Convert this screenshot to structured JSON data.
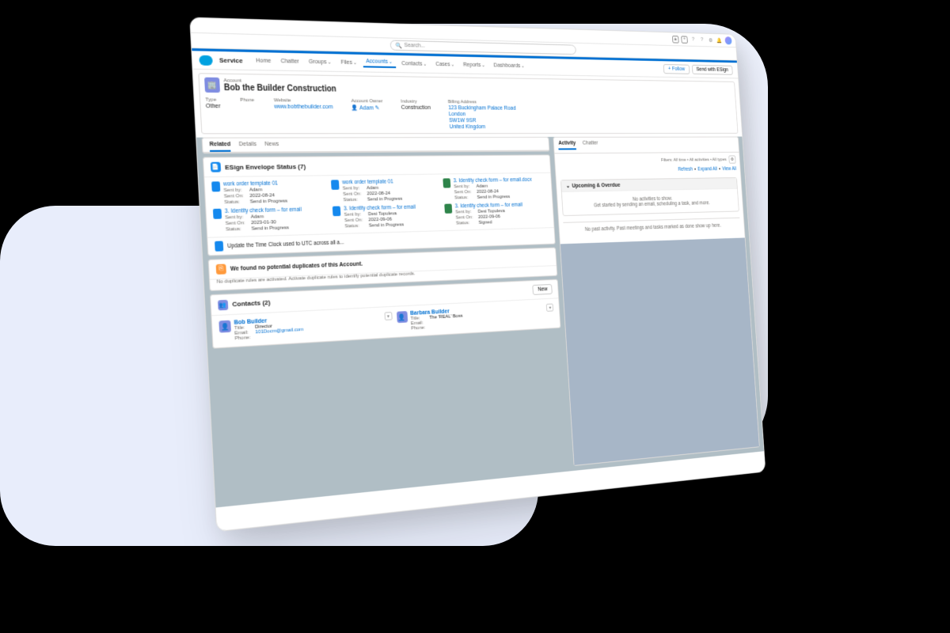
{
  "search": {
    "placeholder": "Search..."
  },
  "globalIcons": {
    "star": "★",
    "plus": "+",
    "help": "?",
    "q": "?",
    "gear": "⚙",
    "bell": "🔔"
  },
  "app": {
    "name": "Service"
  },
  "nav": {
    "items": [
      {
        "label": "Home"
      },
      {
        "label": "Chatter"
      },
      {
        "label": "Groups"
      },
      {
        "label": "Files"
      },
      {
        "label": "Accounts",
        "active": true
      },
      {
        "label": "Contacts"
      },
      {
        "label": "Cases"
      },
      {
        "label": "Reports"
      },
      {
        "label": "Dashboards"
      }
    ]
  },
  "buttons": {
    "follow": "+ Follow",
    "sendEsign": "Send with ESign",
    "new": "New"
  },
  "header": {
    "label": "Account",
    "title": "Bob the Builder Construction",
    "fields": {
      "type": {
        "label": "Type",
        "value": "Other"
      },
      "phone": {
        "label": "Phone",
        "value": ""
      },
      "website": {
        "label": "Website",
        "value": "www.bobthebuilder.com"
      },
      "owner": {
        "label": "Account Owner",
        "value": "Adam"
      },
      "industry": {
        "label": "Industry",
        "value": "Construction"
      },
      "billing": {
        "label": "Billing Address",
        "line1": "123 Buckingham Palace Road",
        "line2": "London",
        "line3": "SW1W 9SR",
        "line4": "United Kingdom"
      }
    }
  },
  "leftTabs": [
    "Related",
    "Details",
    "News"
  ],
  "esign": {
    "title": "ESign Envelope Status (7)",
    "items": [
      {
        "color": "blue",
        "title": "work order template 01",
        "sentBy": "Adam",
        "sentOn": "2022-08-24",
        "status": "Send in Progress"
      },
      {
        "color": "blue",
        "title": "work order template 01",
        "sentBy": "Adam",
        "sentOn": "2022-08-24",
        "status": "Send in Progress"
      },
      {
        "color": "green",
        "title": "3. Identity check form – for email.docx",
        "sentBy": "Adam",
        "sentOn": "2022-08-24",
        "status": "Send in Progress"
      },
      {
        "color": "blue",
        "title": "3. Identity check form – for email",
        "sentBy": "Adam",
        "sentOn": "2023-01-30",
        "status": "Send in Progress"
      },
      {
        "color": "blue",
        "title": "3. Identity check form – for email",
        "sentBy": "Desi Topuleva",
        "sentOn": "2022-09-06",
        "status": "Send in Progress"
      },
      {
        "color": "green",
        "title": "3. Identity check form – for email",
        "sentBy": "Desi Topuleva",
        "sentOn": "2022-09-06",
        "status": "Signed"
      }
    ],
    "extra": "Update the Time Clock used to UTC across all a...",
    "labels": {
      "sentBy": "Sent by:",
      "sentOn": "Sent On:",
      "status": "Status:"
    }
  },
  "duplicates": {
    "title": "We found no potential duplicates of this Account.",
    "sub": "No duplicate rules are activated. Activate duplicate rules to identify potential duplicate records."
  },
  "contacts": {
    "title": "Contacts (2)",
    "labels": {
      "title": "Title:",
      "email": "Email:",
      "phone": "Phone:"
    },
    "items": [
      {
        "name": "Bob Builder",
        "title": "Director",
        "email": "101Docm@gmail.com",
        "phone": ""
      },
      {
        "name": "Barbara Builder",
        "title": "The 'REAL' Boss",
        "email": "",
        "phone": ""
      }
    ]
  },
  "activity": {
    "tabs": [
      "Activity",
      "Chatter"
    ],
    "filters": "Filters: All time • All activities • All types",
    "links": {
      "refresh": "Refresh",
      "expand": "Expand All",
      "view": "View All"
    },
    "upcoming": {
      "title": "Upcoming & Overdue",
      "line1": "No activities to show.",
      "line2": "Get started by sending an email, scheduling a task, and more."
    },
    "past": "No past activity. Past meetings and tasks marked as done show up here."
  }
}
